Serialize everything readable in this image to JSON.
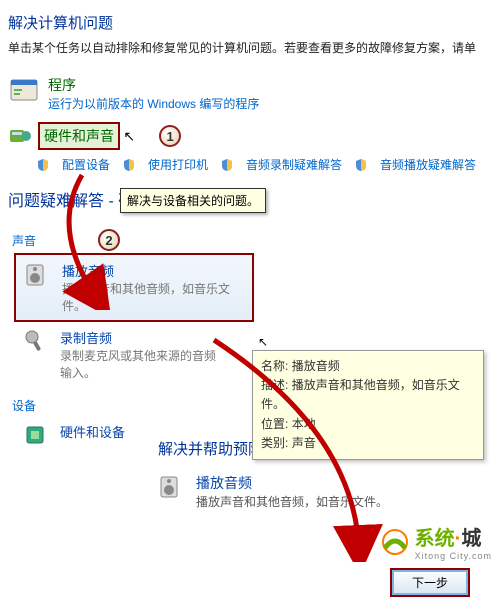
{
  "header": {
    "title": "解决计算机问题",
    "subtitle": "单击某个任务以自动排除和修复常见的计算机问题。若要查看更多的故障修复方案，请单"
  },
  "programs": {
    "title": "程序",
    "sub": "运行为以前版本的 Windows 编写的程序"
  },
  "hardware": {
    "title": "硬件和声音",
    "badge1": "1",
    "links": {
      "a": "配置设备",
      "b": "使用打印机",
      "c": "音频录制疑难解答",
      "d": "音频播放疑难解答"
    }
  },
  "tooltip": "解决与设备相关的问题。",
  "section2": {
    "title": "问题疑难解答 - 硬件和声音",
    "badge2": "2",
    "audio_cat": "声音",
    "item_play": {
      "title": "播放音频",
      "desc": "播放声音和其他音频，如音乐文件。"
    },
    "item_rec": {
      "title": "录制音频",
      "desc": "录制麦克风或其他来源的音频输入。"
    },
    "info": {
      "name_l": "名称:",
      "name_v": "播放音频",
      "desc_l": "描述:",
      "desc_v": "播放声音和其他音频，如音乐文件。",
      "loc_l": "位置:",
      "loc_v": "本地",
      "cat_l": "类别:",
      "cat_v": "声音"
    },
    "device_cat": "设备",
    "dev_item": "硬件和设备",
    "solve_title": "解决并帮助预防计算机问题",
    "bottom_item": {
      "title": "播放音频",
      "desc": "播放声音和其他音频，如音乐文件。"
    }
  },
  "footer": {
    "next": "下一步",
    "logo_green": "系统",
    "logo_dark": "城",
    "logo_sub": "Xitong   City.com"
  }
}
